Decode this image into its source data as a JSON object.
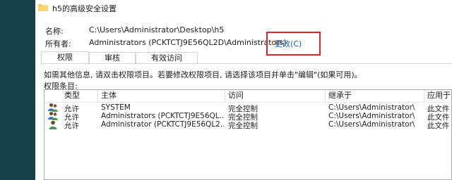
{
  "window": {
    "title": "h5的高级安全设置"
  },
  "name_label": "名称:",
  "name_value": "C:\\Users\\Administrator\\Desktop\\h5",
  "owner_label": "所有者:",
  "owner_value": "Administrators (PCKTCTJ9E56QL2D\\Administrators)",
  "change_link": "更改(C)",
  "tabs": [
    {
      "label": "权限",
      "active": true
    },
    {
      "label": "审核",
      "active": false
    },
    {
      "label": "有效访问",
      "active": false
    }
  ],
  "info_text": "如需其他信息, 请双击权限项目。若要修改权限项目, 请选择该项目并单击\"编辑\"(如果可用)。",
  "entries_label": "权限条目:",
  "columns": [
    "类型",
    "主体",
    "访问",
    "继承于",
    "应用于"
  ],
  "rows": [
    {
      "icon": "group-icon",
      "type": "允许",
      "principal": "SYSTEM",
      "access": "完全控制",
      "inherited": "C:\\Users\\Administrator\\",
      "applies": "此文件"
    },
    {
      "icon": "group-icon",
      "type": "允许",
      "principal": "Administrators (PCKTCTJ9E56QL...",
      "access": "完全控制",
      "inherited": "C:\\Users\\Administrator\\",
      "applies": "此文件"
    },
    {
      "icon": "user-icon",
      "type": "允许",
      "principal": "Administrator (PCKTCTJ9E56QL2...",
      "access": "完全控制",
      "inherited": "C:\\Users\\Administrator\\",
      "applies": "此文件"
    }
  ],
  "colors": {
    "highlight_border": "#d9252b",
    "link": "#1a5fb4",
    "background": "#17404a"
  }
}
